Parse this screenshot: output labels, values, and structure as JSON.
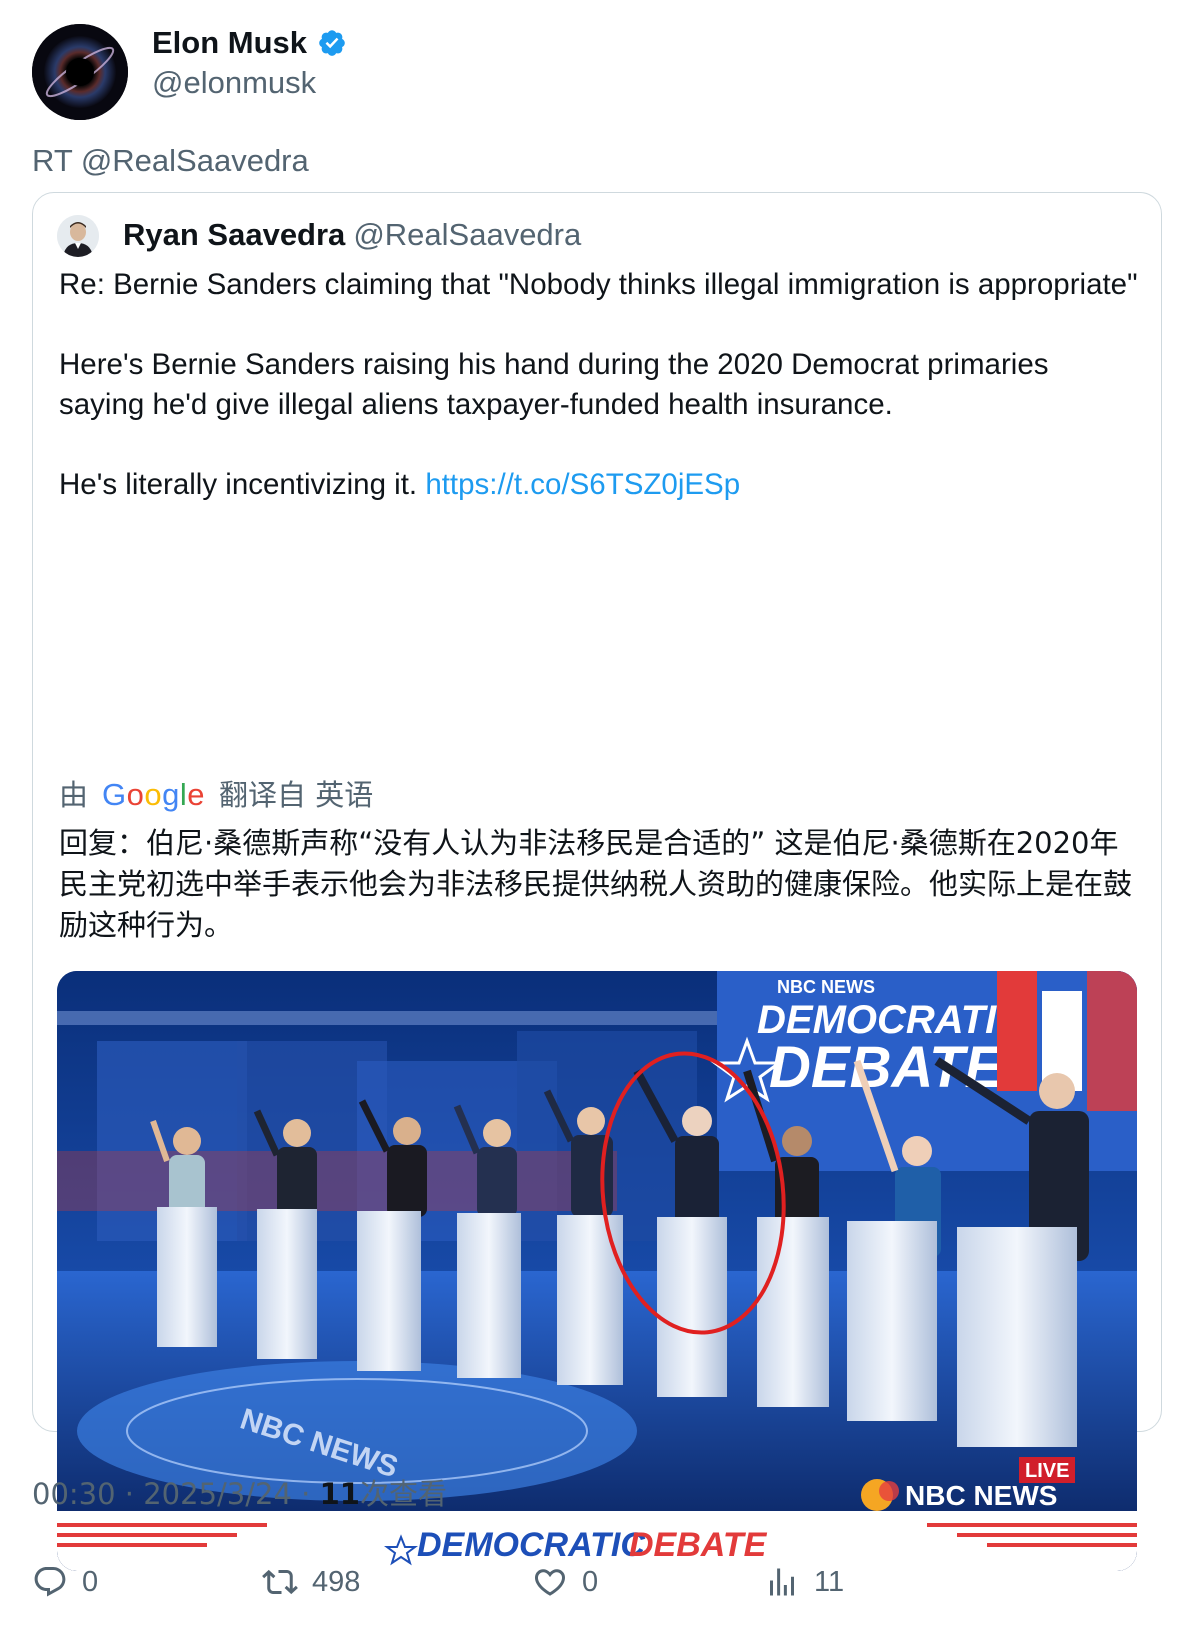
{
  "author": {
    "name": "Elon Musk",
    "handle": "@elonmusk"
  },
  "retweet_line": "RT @RealSaavedra",
  "quoted": {
    "name": "Ryan Saavedra",
    "handle": "@RealSaavedra",
    "paragraphs": {
      "p1": "Re: Bernie Sanders claiming that \"Nobody thinks illegal immigration is appropriate\"",
      "p2": "Here's Bernie Sanders raising his hand during the 2020 Democrat primaries saying he'd give illegal aliens taxpayer-funded health insurance.",
      "p3_text": "He's literally incentivizing it.",
      "p3_link": "https://t.co/S6TSZ0jESp"
    },
    "translate": {
      "by": "由",
      "google": "Google",
      "from": "翻译自 英语"
    },
    "translation": "回复：伯尼·桑德斯声称“没有人认为非法移民是合适的” 这是伯尼·桑德斯在2020年民主党初选中举手表示他会为非法移民提供纳税人资助的健康保险。他实际上是在鼓励这种行为。",
    "media": {
      "banner_top_small": "NBC NEWS",
      "banner_top_line1": "DEMOCRATIC",
      "banner_top_line2": "DEBATE",
      "live_badge": "LIVE",
      "watermark": "NBC NEWS",
      "floor_logo": "NBC NEWS",
      "bottom_banner_a": "DEMOCRATIC",
      "bottom_banner_b": "DEBATE"
    }
  },
  "meta": {
    "time": "00:30",
    "sep1": "·",
    "date": "2025/3/24",
    "sep2": "·",
    "views_num": "11",
    "views_label": "次查看"
  },
  "actions": {
    "reply": "0",
    "retweet": "498",
    "like": "0",
    "views": "11"
  },
  "colors": {
    "link": "#1d9bf0",
    "muted": "#536471",
    "verified": "#1d9bf0"
  }
}
